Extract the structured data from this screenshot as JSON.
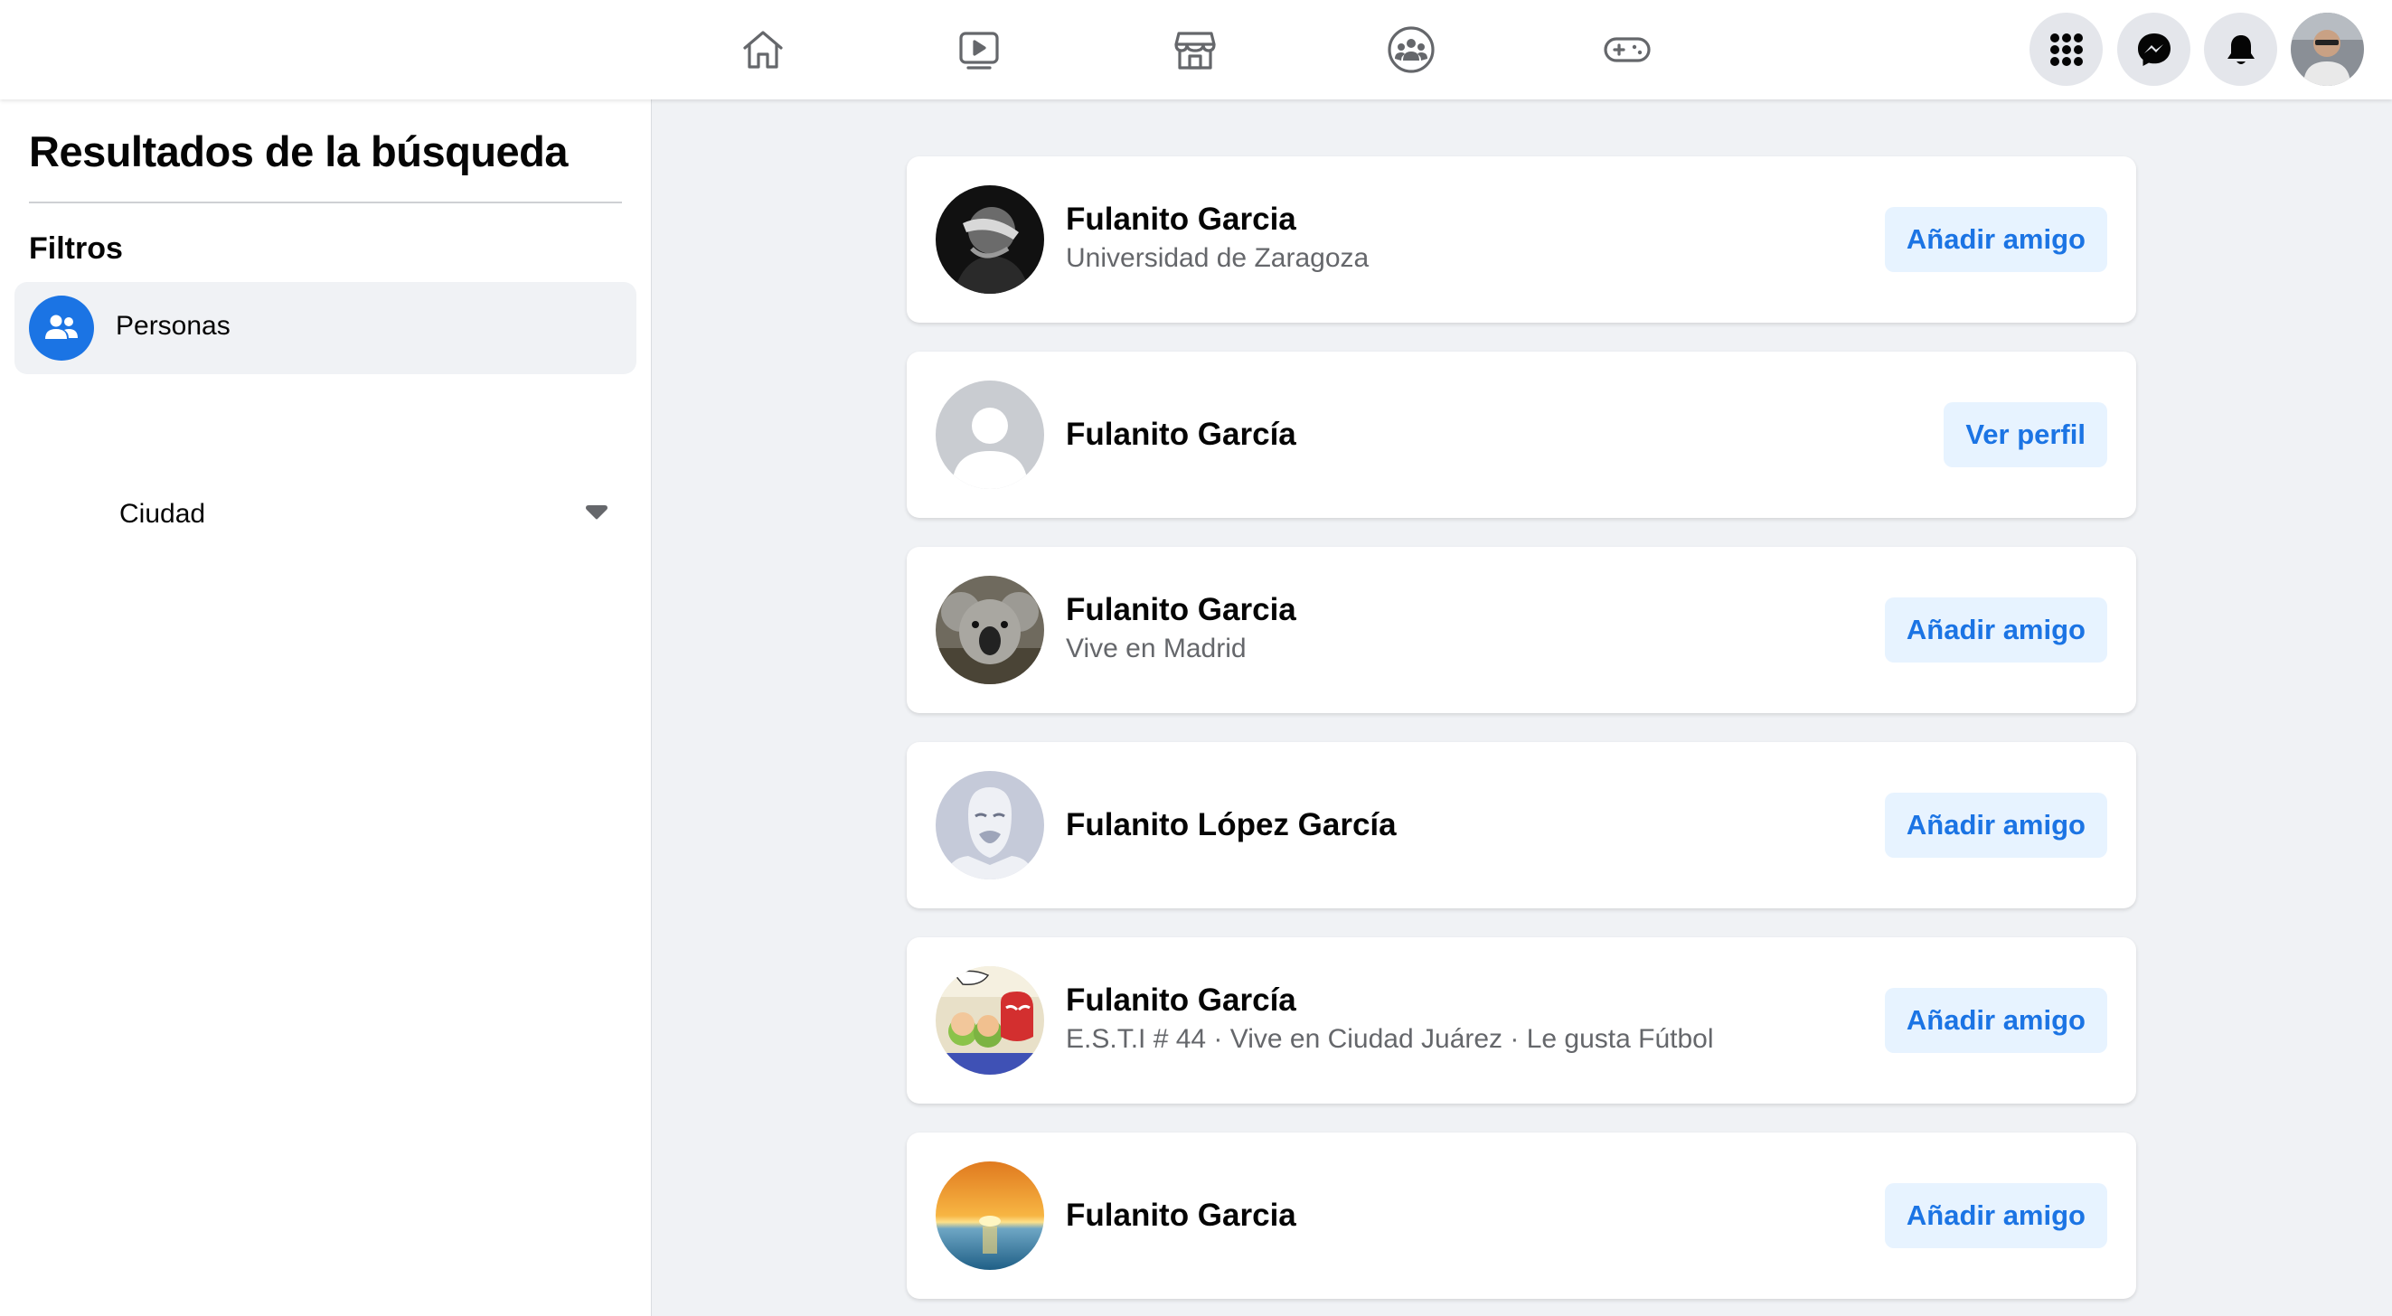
{
  "colors": {
    "accent": "#1b74e4",
    "button_bg": "#e7f3ff",
    "page_bg": "#f0f2f5",
    "secondary_text": "#65676b"
  },
  "topnav": {
    "icons": [
      "home-icon",
      "watch-video-icon",
      "marketplace-store-icon",
      "groups-icon",
      "gaming-icon"
    ],
    "right_buttons": [
      "menu-grid-icon",
      "messenger-icon",
      "notifications-bell-icon",
      "profile-avatar"
    ]
  },
  "sidebar": {
    "title": "Resultados de la búsqueda",
    "filters_label": "Filtros",
    "filter_item": {
      "label": "Personas",
      "icon": "people-icon"
    },
    "city_filter": {
      "label": "Ciudad",
      "icon": "caret-down-icon"
    }
  },
  "results": [
    {
      "name": "Fulanito Garcia",
      "subtitle": "Universidad de Zaragoza",
      "button": "Añadir amigo",
      "avatar": "dark-photo"
    },
    {
      "name": "Fulanito García",
      "subtitle": "",
      "button": "Ver perfil",
      "avatar": "default-silhouette"
    },
    {
      "name": "Fulanito Garcia",
      "subtitle": "Vive en Madrid",
      "button": "Añadir amigo",
      "avatar": "koala"
    },
    {
      "name": "Fulanito López García",
      "subtitle": "",
      "button": "Añadir amigo",
      "avatar": "mask"
    },
    {
      "name": "Fulanito García",
      "subtitle": "E.S.T.I # 44 · Vive en Ciudad Juárez · Le gusta Fútbol",
      "button": "Añadir amigo",
      "avatar": "comic"
    },
    {
      "name": "Fulanito Garcia",
      "subtitle": "",
      "button": "Añadir amigo",
      "avatar": "sunset"
    }
  ]
}
